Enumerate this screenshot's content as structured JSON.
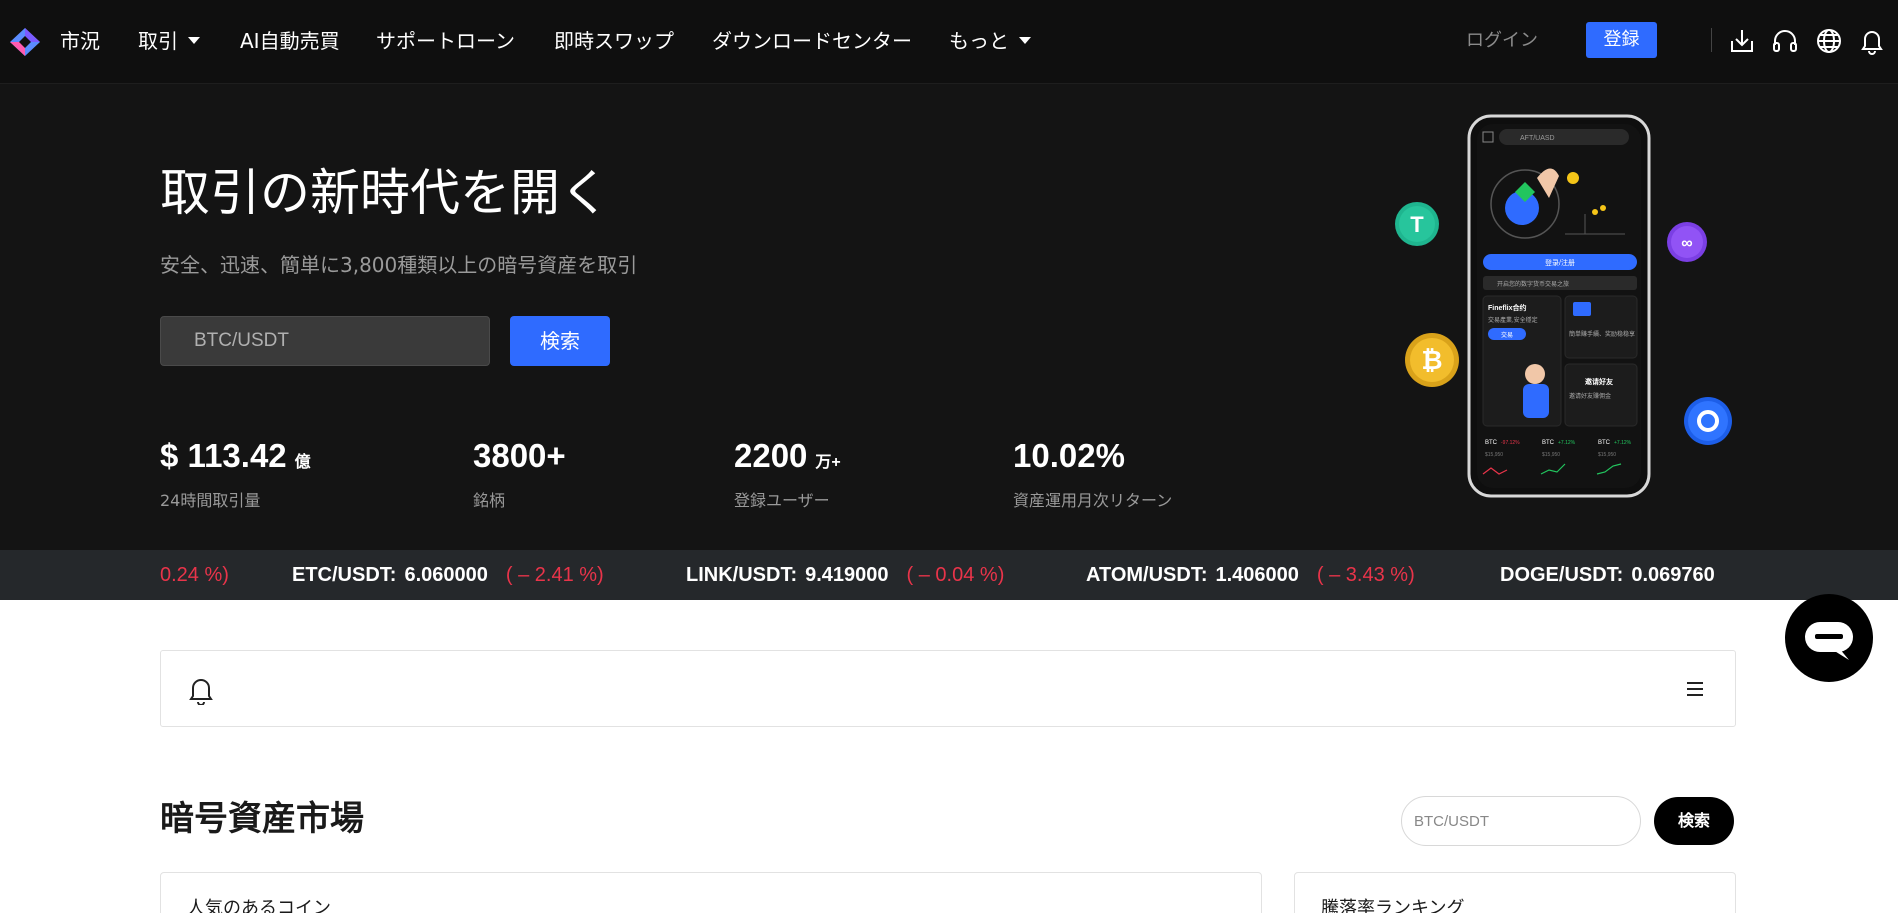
{
  "nav": {
    "items": [
      {
        "label": "市況",
        "dropdown": false
      },
      {
        "label": "取引",
        "dropdown": true
      },
      {
        "label": "AI自動売買",
        "dropdown": false
      },
      {
        "label": "サポートローン",
        "dropdown": false
      },
      {
        "label": "即時スワップ",
        "dropdown": false
      },
      {
        "label": "ダウンロードセンター",
        "dropdown": false
      },
      {
        "label": "もっと",
        "dropdown": true
      }
    ],
    "login": "ログイン",
    "register": "登録",
    "icons": [
      "download-icon",
      "headset-icon",
      "globe-icon",
      "bell-icon"
    ]
  },
  "hero": {
    "title": "取引の新時代を開く",
    "subtitle": "安全、迅速、簡単に3,800種類以上の暗号資産を取引",
    "search": {
      "placeholder": "BTC/USDT",
      "button": "検索"
    },
    "stats": [
      {
        "prefix": "$ ",
        "value": "113.42",
        "unit": "億",
        "label": "24時間取引量"
      },
      {
        "prefix": "",
        "value": "3800+",
        "unit": "",
        "label": "銘柄"
      },
      {
        "prefix": "",
        "value": "2200",
        "unit": "万+",
        "label": "登録ユーザー"
      },
      {
        "prefix": "",
        "value": "10.02%",
        "unit": "",
        "label": "資産運用月次リターン"
      }
    ],
    "phone": {
      "search_text": "AFT/UASD",
      "login_button": "登录/注册",
      "notice": "开启您的数字货币交易之旅",
      "card1_title": "Fineflix合约",
      "card1_sub": "交易產業,安全穩定",
      "card1_btn": "交易",
      "card2_sub": "簡単賺手續、奖励稳稳享",
      "card3_title": "邀请好友",
      "card3_sub": "邀请好友赚佣金",
      "tickers": [
        {
          "pair": "BTC",
          "change": "-97.12%",
          "price": "$15,950"
        },
        {
          "pair": "BTC",
          "change": "+7.12%",
          "price": "$15,950"
        },
        {
          "pair": "BTC",
          "change": "+7.12%",
          "price": "$15,950"
        }
      ]
    }
  },
  "ticker": {
    "partial_change": "0.24 %)",
    "items": [
      {
        "pair": "ETC/USDT:",
        "price": "6.060000",
        "change": "( – 2.41 %)"
      },
      {
        "pair": "LINK/USDT:",
        "price": "9.419000",
        "change": "( – 0.04 %)"
      },
      {
        "pair": "ATOM/USDT:",
        "price": "1.406000",
        "change": "( – 3.43 %)"
      },
      {
        "pair": "DOGE/USDT:",
        "price": "0.069760",
        "change": ""
      }
    ]
  },
  "market": {
    "title": "暗号資産市場",
    "search_placeholder": "BTC/USDT",
    "search_button": "検索",
    "popular_title": "人気のあるコイン",
    "ranking_title": "騰落率ランキング"
  },
  "colors": {
    "accent": "#2f6bff",
    "nav_bg": "#0f0f0f",
    "hero_bg": "#141414",
    "ticker_bg": "#25282b",
    "down": "#e9344a",
    "up": "#22c55e"
  }
}
